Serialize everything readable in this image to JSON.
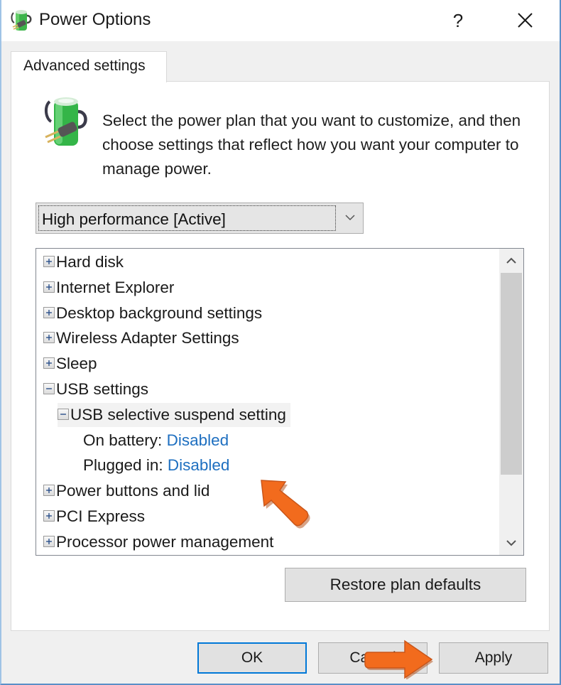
{
  "window": {
    "title": "Power Options",
    "help_label": "?",
    "close_icon": "close-icon"
  },
  "tabs": [
    {
      "label": "Advanced settings",
      "active": true
    }
  ],
  "description": "Select the power plan that you want to customize, and then choose settings that reflect how you want your computer to manage power.",
  "plan_select": {
    "selected": "High performance [Active]",
    "icon": "chevron-down-icon"
  },
  "tree": {
    "items": [
      {
        "label": "Hard disk",
        "state": "collapsed",
        "level": 0
      },
      {
        "label": "Internet Explorer",
        "state": "collapsed",
        "level": 0
      },
      {
        "label": "Desktop background settings",
        "state": "collapsed",
        "level": 0
      },
      {
        "label": "Wireless Adapter Settings",
        "state": "collapsed",
        "level": 0
      },
      {
        "label": "Sleep",
        "state": "collapsed",
        "level": 0
      },
      {
        "label": "USB settings",
        "state": "expanded",
        "level": 0
      },
      {
        "label": "USB selective suspend setting",
        "state": "expanded",
        "level": 1,
        "selected": true
      },
      {
        "label": "On battery:",
        "value": "Disabled",
        "level": 2
      },
      {
        "label": "Plugged in:",
        "value": "Disabled",
        "level": 2
      },
      {
        "label": "Power buttons and lid",
        "state": "collapsed",
        "level": 0
      },
      {
        "label": "PCI Express",
        "state": "collapsed",
        "level": 0
      },
      {
        "label": "Processor power management",
        "state": "collapsed",
        "level": 0
      }
    ],
    "scroll_position_fraction": 0.0,
    "visible_fraction": 0.72
  },
  "buttons": {
    "restore": "Restore plan defaults",
    "ok": "OK",
    "cancel": "Cancel",
    "apply": "Apply"
  },
  "colors": {
    "accent": "#0078d7",
    "value_link": "#1e6fc0",
    "annotation_arrow": "#f26b1d"
  }
}
